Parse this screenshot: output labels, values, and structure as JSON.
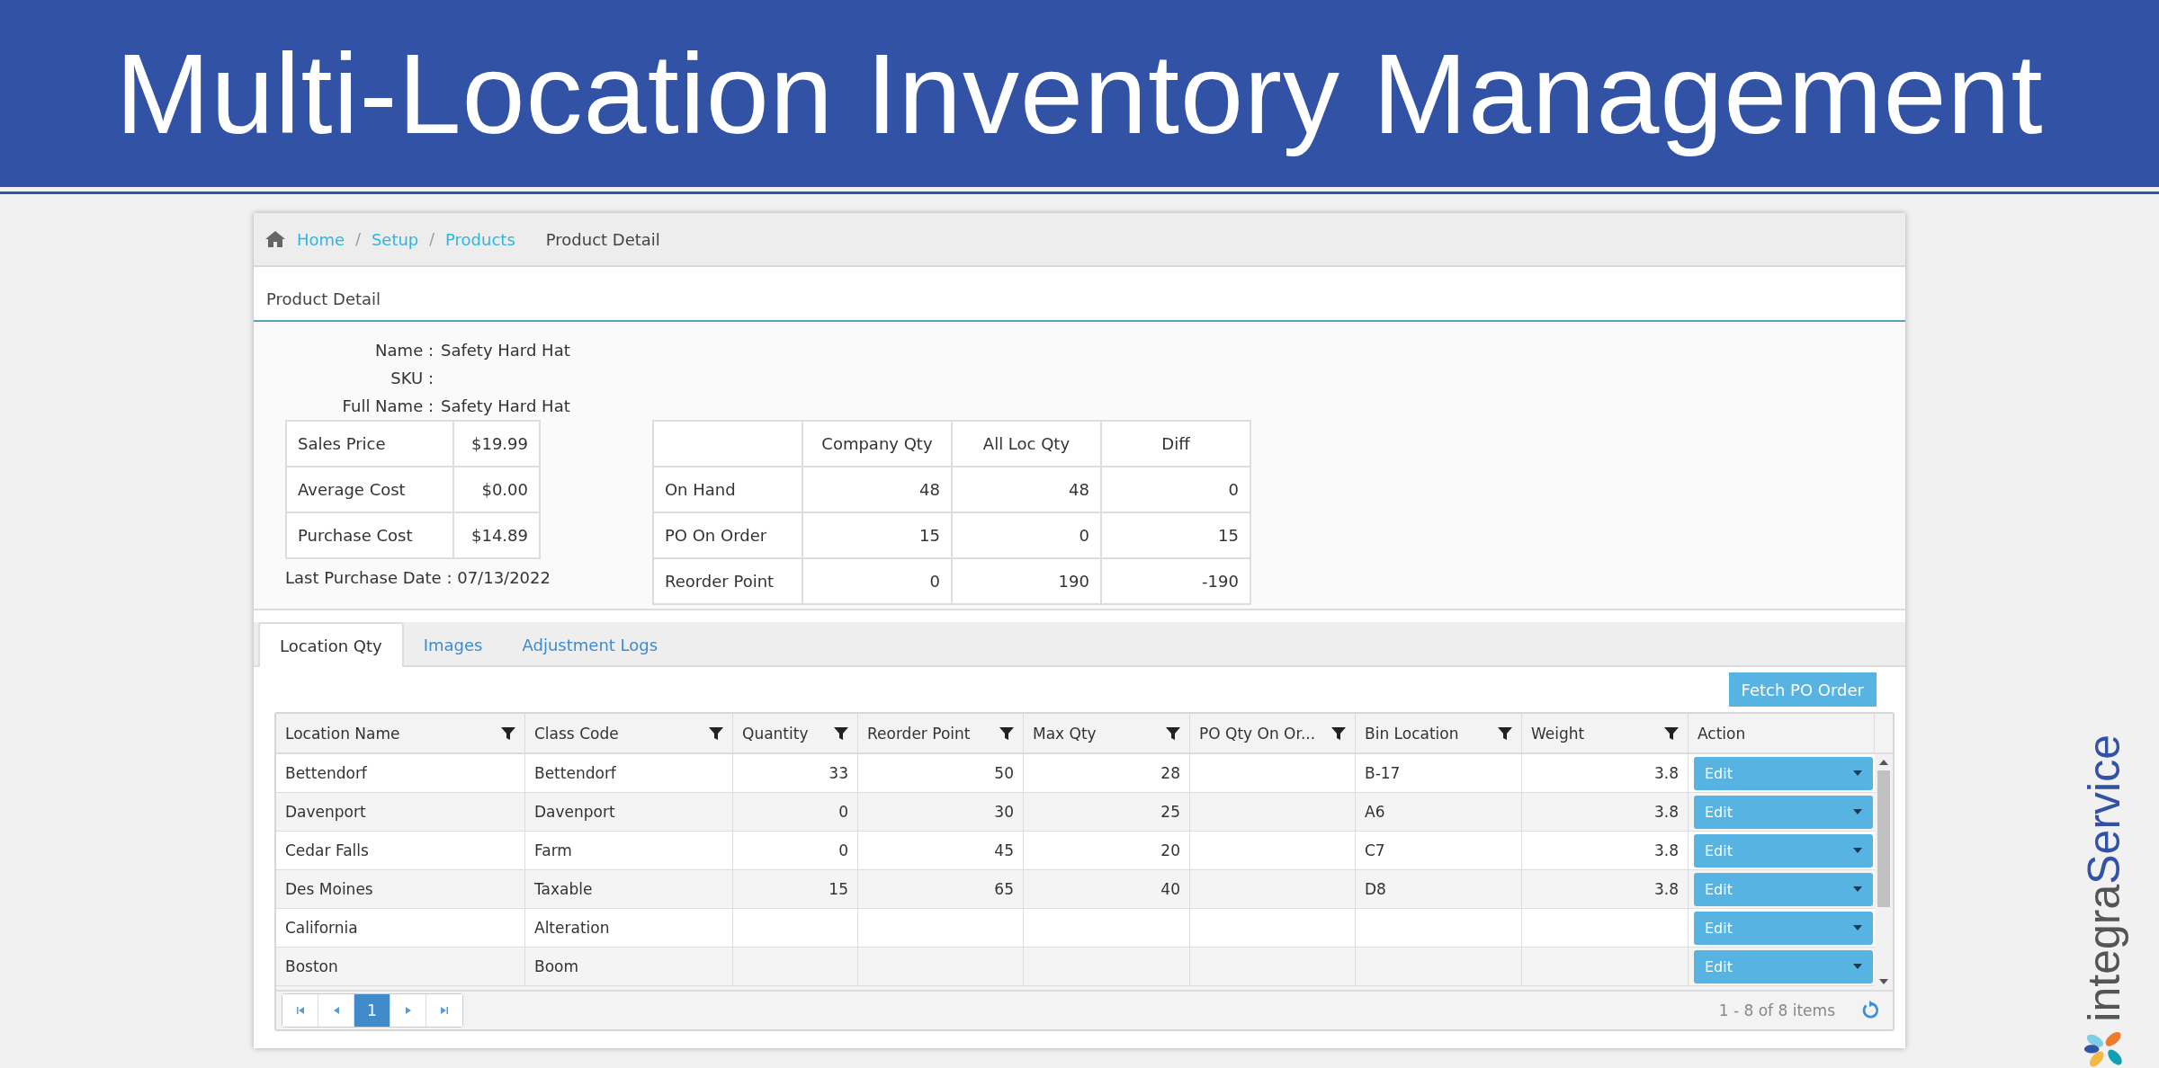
{
  "banner": {
    "title": "Multi-Location Inventory Management"
  },
  "breadcrumb": {
    "links": [
      "Home",
      "Setup",
      "Products"
    ],
    "separator": "/",
    "current": "Product Detail"
  },
  "panel": {
    "title": "Product Detail"
  },
  "product": {
    "fields": [
      {
        "label": "Name :",
        "value": "Safety Hard Hat"
      },
      {
        "label": "SKU :"
      },
      {
        "label": "Full Name :",
        "value": "Safety Hard Hat"
      }
    ],
    "prices": [
      {
        "label": "Sales Price",
        "value": "$19.99"
      },
      {
        "label": "Average Cost",
        "value": "$0.00"
      },
      {
        "label": "Purchase Cost",
        "value": "$14.89"
      }
    ],
    "last_purchase": "Last Purchase Date : 07/13/2022"
  },
  "qty_table": {
    "columns": [
      "Company Qty",
      "All Loc Qty",
      "Diff"
    ],
    "rows": [
      {
        "label": "On Hand",
        "values": [
          "48",
          "48",
          "0"
        ]
      },
      {
        "label": "PO On Order",
        "values": [
          "15",
          "0",
          "15"
        ]
      },
      {
        "label": "Reorder Point",
        "values": [
          "0",
          "190",
          "-190"
        ]
      }
    ]
  },
  "tabs": [
    {
      "label": "Location Qty",
      "selected": true
    },
    {
      "label": "Images",
      "selected": false
    },
    {
      "label": "Adjustment Logs",
      "selected": false
    }
  ],
  "fetch_button": "Fetch PO Order",
  "grid": {
    "columns": [
      {
        "label": "Location Name",
        "filter": true
      },
      {
        "label": "Class Code",
        "filter": true
      },
      {
        "label": "Quantity",
        "filter": true
      },
      {
        "label": "Reorder Point",
        "filter": true
      },
      {
        "label": "Max Qty",
        "filter": true
      },
      {
        "label": "PO Qty On Or...",
        "filter": true
      },
      {
        "label": "Bin Location",
        "filter": true
      },
      {
        "label": "Weight",
        "filter": true
      },
      {
        "label": "Action",
        "filter": false
      }
    ],
    "rows": [
      {
        "cells": [
          "Bettendorf",
          "Bettendorf",
          "33",
          "50",
          "28",
          null,
          "B-17",
          "3.8"
        ],
        "action": "Edit"
      },
      {
        "cells": [
          "Davenport",
          "Davenport",
          "0",
          "30",
          "25",
          null,
          "A6",
          "3.8"
        ],
        "action": "Edit"
      },
      {
        "cells": [
          "Cedar Falls",
          "Farm",
          "0",
          "45",
          "20",
          null,
          "C7",
          "3.8"
        ],
        "action": "Edit"
      },
      {
        "cells": [
          "Des Moines",
          "Taxable",
          "15",
          "65",
          "40",
          null,
          "D8",
          "3.8"
        ],
        "action": "Edit"
      },
      {
        "cells": [
          "California",
          "Alteration",
          null,
          null,
          null,
          null,
          null,
          null
        ],
        "action": "Edit"
      },
      {
        "cells": [
          "Boston",
          "Boom",
          null,
          null,
          null,
          null,
          null,
          null
        ],
        "action": "Edit"
      }
    ]
  },
  "pager": {
    "pages": [
      {
        "label": "1",
        "selected": true
      }
    ],
    "summary": "1 - 8 of 8 items"
  },
  "brand": {
    "prefix": "integra",
    "suffix": "Service"
  }
}
